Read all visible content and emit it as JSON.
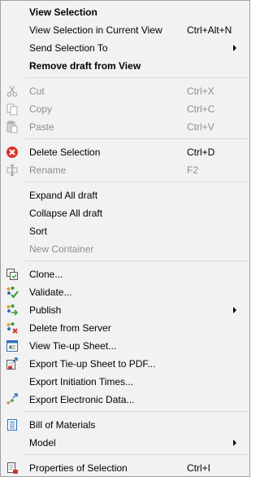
{
  "menu": {
    "view_selection": "View Selection",
    "view_selection_current": "View Selection in Current View",
    "view_selection_current_shortcut": "Ctrl+Alt+N",
    "send_selection_to": "Send Selection To",
    "remove_draft": "Remove draft from View",
    "cut": "Cut",
    "cut_shortcut": "Ctrl+X",
    "copy": "Copy",
    "copy_shortcut": "Ctrl+C",
    "paste": "Paste",
    "paste_shortcut": "Ctrl+V",
    "delete_selection": "Delete Selection",
    "delete_selection_shortcut": "Ctrl+D",
    "rename": "Rename",
    "rename_shortcut": "F2",
    "expand_all": "Expand All draft",
    "collapse_all": "Collapse All draft",
    "sort": "Sort",
    "new_container": "New Container",
    "clone": "Clone...",
    "validate": "Validate...",
    "publish": "Publish",
    "delete_from_server": "Delete from Server",
    "view_tieup": "View Tie-up Sheet...",
    "export_tieup_pdf": "Export Tie-up Sheet to PDF...",
    "export_initiation": "Export Initiation Times...",
    "export_electronic": "Export Electronic Data...",
    "bill_of_materials": "Bill of Materials",
    "model": "Model",
    "properties": "Properties of Selection",
    "properties_shortcut": "Ctrl+I"
  },
  "icons": {
    "cut": "scissors-icon",
    "copy": "copy-icon",
    "paste": "paste-icon",
    "delete": "delete-red-x-icon",
    "rename": "rename-cursor-icon",
    "clone": "clone-icon",
    "validate": "validate-check-icon",
    "publish": "publish-icon",
    "delete_server": "delete-server-icon",
    "view_tieup": "tieup-sheet-icon",
    "export_pdf": "export-pdf-icon",
    "export_electronic": "export-electronic-icon",
    "bom": "bill-of-materials-icon",
    "properties": "properties-icon"
  },
  "colors": {
    "background": "#f2f2f2",
    "disabled_text": "#8d8d8d",
    "delete_red": "#d9342b",
    "accent_green": "#3a9a3a",
    "accent_blue": "#2e6fb7"
  }
}
